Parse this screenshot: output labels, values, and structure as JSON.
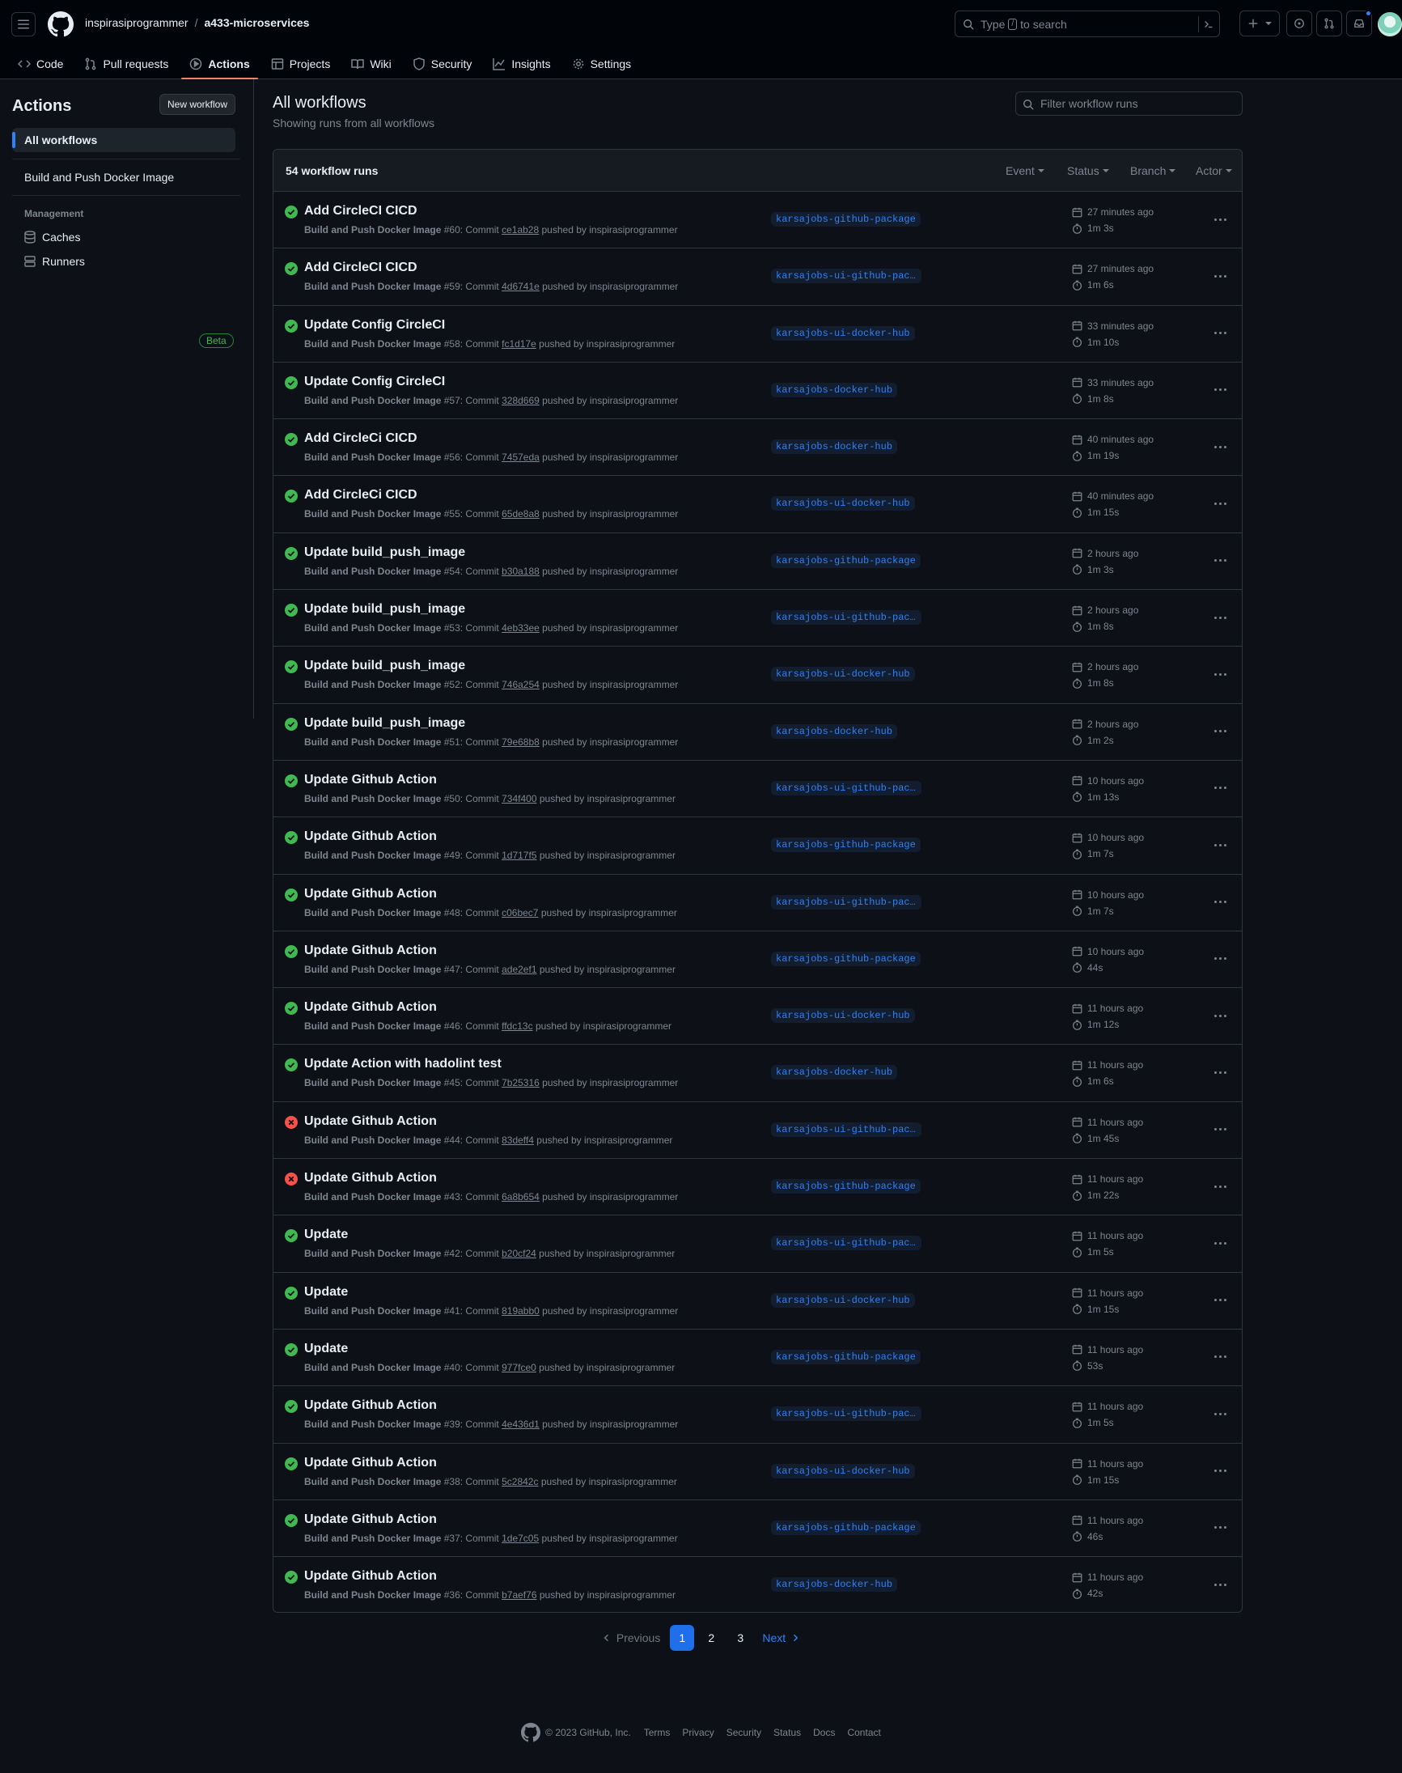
{
  "header": {
    "owner": "inspirasiprogrammer",
    "separator": "/",
    "repo": "a433-microservices",
    "search_prefix": "Type",
    "search_key": "/",
    "search_suffix": "to search"
  },
  "nav_tabs": [
    {
      "label": "Code",
      "icon": "code-icon"
    },
    {
      "label": "Pull requests",
      "icon": "pull-request-icon"
    },
    {
      "label": "Actions",
      "icon": "play-icon",
      "active": true
    },
    {
      "label": "Projects",
      "icon": "table-icon"
    },
    {
      "label": "Wiki",
      "icon": "book-icon"
    },
    {
      "label": "Security",
      "icon": "shield-icon"
    },
    {
      "label": "Insights",
      "icon": "graph-icon"
    },
    {
      "label": "Settings",
      "icon": "gear-icon"
    }
  ],
  "sidebar": {
    "title": "Actions",
    "new_workflow": "New workflow",
    "all_workflows": "All workflows",
    "workflow": "Build and Push Docker Image",
    "management_heading": "Management",
    "caches": "Caches",
    "runners": "Runners",
    "beta": "Beta"
  },
  "main": {
    "title": "All workflows",
    "subtitle": "Showing runs from all workflows",
    "filter_placeholder": "Filter workflow runs",
    "runs_count": "54 workflow runs",
    "filters": [
      "Event",
      "Status",
      "Branch",
      "Actor"
    ]
  },
  "runs": [
    {
      "status": "success",
      "title": "Add CircleCI CICD",
      "workflow": "Build and Push Docker Image",
      "num": "#60",
      "sha": "ce1ab28",
      "actor": "inspirasiprogrammer",
      "branch": "karsajobs-github-package",
      "time": "27 minutes ago",
      "duration": "1m 3s"
    },
    {
      "status": "success",
      "title": "Add CircleCI CICD",
      "workflow": "Build and Push Docker Image",
      "num": "#59",
      "sha": "4d6741e",
      "actor": "inspirasiprogrammer",
      "branch": "karsajobs-ui-github-packa…",
      "time": "27 minutes ago",
      "duration": "1m 6s"
    },
    {
      "status": "success",
      "title": "Update Config CircleCI",
      "workflow": "Build and Push Docker Image",
      "num": "#58",
      "sha": "fc1d17e",
      "actor": "inspirasiprogrammer",
      "branch": "karsajobs-ui-docker-hub",
      "time": "33 minutes ago",
      "duration": "1m 10s"
    },
    {
      "status": "success",
      "title": "Update Config CircleCI",
      "workflow": "Build and Push Docker Image",
      "num": "#57",
      "sha": "328d669",
      "actor": "inspirasiprogrammer",
      "branch": "karsajobs-docker-hub",
      "time": "33 minutes ago",
      "duration": "1m 8s"
    },
    {
      "status": "success",
      "title": "Add CircleCi CICD",
      "workflow": "Build and Push Docker Image",
      "num": "#56",
      "sha": "7457eda",
      "actor": "inspirasiprogrammer",
      "branch": "karsajobs-docker-hub",
      "time": "40 minutes ago",
      "duration": "1m 19s"
    },
    {
      "status": "success",
      "title": "Add CircleCi CICD",
      "workflow": "Build and Push Docker Image",
      "num": "#55",
      "sha": "65de8a8",
      "actor": "inspirasiprogrammer",
      "branch": "karsajobs-ui-docker-hub",
      "time": "40 minutes ago",
      "duration": "1m 15s"
    },
    {
      "status": "success",
      "title": "Update build_push_image",
      "workflow": "Build and Push Docker Image",
      "num": "#54",
      "sha": "b30a188",
      "actor": "inspirasiprogrammer",
      "branch": "karsajobs-github-package",
      "time": "2 hours ago",
      "duration": "1m 3s"
    },
    {
      "status": "success",
      "title": "Update build_push_image",
      "workflow": "Build and Push Docker Image",
      "num": "#53",
      "sha": "4eb33ee",
      "actor": "inspirasiprogrammer",
      "branch": "karsajobs-ui-github-packa…",
      "time": "2 hours ago",
      "duration": "1m 8s"
    },
    {
      "status": "success",
      "title": "Update build_push_image",
      "workflow": "Build and Push Docker Image",
      "num": "#52",
      "sha": "746a254",
      "actor": "inspirasiprogrammer",
      "branch": "karsajobs-ui-docker-hub",
      "time": "2 hours ago",
      "duration": "1m 8s"
    },
    {
      "status": "success",
      "title": "Update build_push_image",
      "workflow": "Build and Push Docker Image",
      "num": "#51",
      "sha": "79e68b8",
      "actor": "inspirasiprogrammer",
      "branch": "karsajobs-docker-hub",
      "time": "2 hours ago",
      "duration": "1m 2s"
    },
    {
      "status": "success",
      "title": "Update Github Action",
      "workflow": "Build and Push Docker Image",
      "num": "#50",
      "sha": "734f400",
      "actor": "inspirasiprogrammer",
      "branch": "karsajobs-ui-github-packa…",
      "time": "10 hours ago",
      "duration": "1m 13s"
    },
    {
      "status": "success",
      "title": "Update Github Action",
      "workflow": "Build and Push Docker Image",
      "num": "#49",
      "sha": "1d717f5",
      "actor": "inspirasiprogrammer",
      "branch": "karsajobs-github-package",
      "time": "10 hours ago",
      "duration": "1m 7s"
    },
    {
      "status": "success",
      "title": "Update Github Action",
      "workflow": "Build and Push Docker Image",
      "num": "#48",
      "sha": "c06bec7",
      "actor": "inspirasiprogrammer",
      "branch": "karsajobs-ui-github-packa…",
      "time": "10 hours ago",
      "duration": "1m 7s"
    },
    {
      "status": "success",
      "title": "Update Github Action",
      "workflow": "Build and Push Docker Image",
      "num": "#47",
      "sha": "ade2ef1",
      "actor": "inspirasiprogrammer",
      "branch": "karsajobs-github-package",
      "time": "10 hours ago",
      "duration": "44s"
    },
    {
      "status": "success",
      "title": "Update Github Action",
      "workflow": "Build and Push Docker Image",
      "num": "#46",
      "sha": "ffdc13c",
      "actor": "inspirasiprogrammer",
      "branch": "karsajobs-ui-docker-hub",
      "time": "11 hours ago",
      "duration": "1m 12s"
    },
    {
      "status": "success",
      "title": "Update Action with hadolint test",
      "workflow": "Build and Push Docker Image",
      "num": "#45",
      "sha": "7b25316",
      "actor": "inspirasiprogrammer",
      "branch": "karsajobs-docker-hub",
      "time": "11 hours ago",
      "duration": "1m 6s"
    },
    {
      "status": "failure",
      "title": "Update Github Action",
      "workflow": "Build and Push Docker Image",
      "num": "#44",
      "sha": "83deff4",
      "actor": "inspirasiprogrammer",
      "branch": "karsajobs-ui-github-packa…",
      "time": "11 hours ago",
      "duration": "1m 45s"
    },
    {
      "status": "failure",
      "title": "Update Github Action",
      "workflow": "Build and Push Docker Image",
      "num": "#43",
      "sha": "6a8b654",
      "actor": "inspirasiprogrammer",
      "branch": "karsajobs-github-package",
      "time": "11 hours ago",
      "duration": "1m 22s"
    },
    {
      "status": "success",
      "title": "Update",
      "workflow": "Build and Push Docker Image",
      "num": "#42",
      "sha": "b20cf24",
      "actor": "inspirasiprogrammer",
      "branch": "karsajobs-ui-github-packa…",
      "time": "11 hours ago",
      "duration": "1m 5s"
    },
    {
      "status": "success",
      "title": "Update",
      "workflow": "Build and Push Docker Image",
      "num": "#41",
      "sha": "819abb0",
      "actor": "inspirasiprogrammer",
      "branch": "karsajobs-ui-docker-hub",
      "time": "11 hours ago",
      "duration": "1m 15s"
    },
    {
      "status": "success",
      "title": "Update",
      "workflow": "Build and Push Docker Image",
      "num": "#40",
      "sha": "977fce0",
      "actor": "inspirasiprogrammer",
      "branch": "karsajobs-github-package",
      "time": "11 hours ago",
      "duration": "53s"
    },
    {
      "status": "success",
      "title": "Update Github Action",
      "workflow": "Build and Push Docker Image",
      "num": "#39",
      "sha": "4e436d1",
      "actor": "inspirasiprogrammer",
      "branch": "karsajobs-ui-github-packa…",
      "time": "11 hours ago",
      "duration": "1m 5s"
    },
    {
      "status": "success",
      "title": "Update Github Action",
      "workflow": "Build and Push Docker Image",
      "num": "#38",
      "sha": "5c2842c",
      "actor": "inspirasiprogrammer",
      "branch": "karsajobs-ui-docker-hub",
      "time": "11 hours ago",
      "duration": "1m 15s"
    },
    {
      "status": "success",
      "title": "Update Github Action",
      "workflow": "Build and Push Docker Image",
      "num": "#37",
      "sha": "1de7c05",
      "actor": "inspirasiprogrammer",
      "branch": "karsajobs-github-package",
      "time": "11 hours ago",
      "duration": "46s"
    },
    {
      "status": "success",
      "title": "Update Github Action",
      "workflow": "Build and Push Docker Image",
      "num": "#36",
      "sha": "b7aef76",
      "actor": "inspirasiprogrammer",
      "branch": "karsajobs-docker-hub",
      "time": "11 hours ago",
      "duration": "42s"
    }
  ],
  "run_labels": {
    "commit": "Commit",
    "pushed_by": "pushed by"
  },
  "pagination": {
    "previous": "Previous",
    "pages": [
      "1",
      "2",
      "3"
    ],
    "current": "1",
    "next": "Next"
  },
  "footer": {
    "copyright": "© 2023 GitHub, Inc.",
    "links": [
      "Terms",
      "Privacy",
      "Security",
      "Status",
      "Docs",
      "Contact"
    ]
  },
  "colors": {
    "success": "#3fb950",
    "failure": "#f85149",
    "accent": "#2f81f7",
    "tab_underline": "#f78166"
  }
}
